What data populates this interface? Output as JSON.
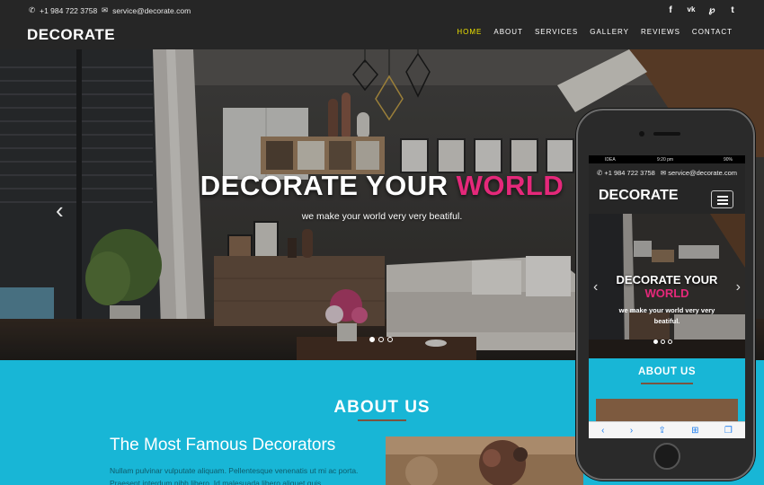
{
  "topbar": {
    "phone": "+1 984 722 3758",
    "email": "service@decorate.com",
    "brand": "DECORATE",
    "social": [
      "f",
      "vk",
      "p",
      "t"
    ],
    "social_icons": [
      "facebook-icon",
      "vk-icon",
      "pinterest-icon",
      "twitter-icon"
    ]
  },
  "nav": {
    "items": [
      "HOME",
      "ABOUT",
      "SERVICES",
      "GALLERY",
      "REVIEWS",
      "CONTACT"
    ],
    "active": "HOME",
    "active_color": "#ede200"
  },
  "hero": {
    "title_main": "DECORATE YOUR",
    "title_accent": "WORLD",
    "subtitle": "we make your world very very beatiful.",
    "accent_color": "#e5287a",
    "slides": 3,
    "active_slide": 1
  },
  "about": {
    "title": "ABOUT US",
    "subtitle": "The Most Famous Decorators",
    "text": "Nullam pulvinar vulputate aliquam. Pellentesque venenatis ut mi ac porta. Praesent interdum nibh libero. Id malesuada libero aliquet quis.",
    "bg_color": "#18b6d6"
  },
  "phone": {
    "status_carrier": "IDEA",
    "status_time": "9:20 pm",
    "status_battery": "90%",
    "phone": "+1 984 722 3758",
    "email": "service@decorate.com",
    "brand": "DECORATE",
    "hero_title_main": "DECORATE YOUR",
    "hero_title_accent": "WORLD",
    "hero_subtitle": "we make your world very very beatiful.",
    "about_title": "ABOUT US"
  }
}
